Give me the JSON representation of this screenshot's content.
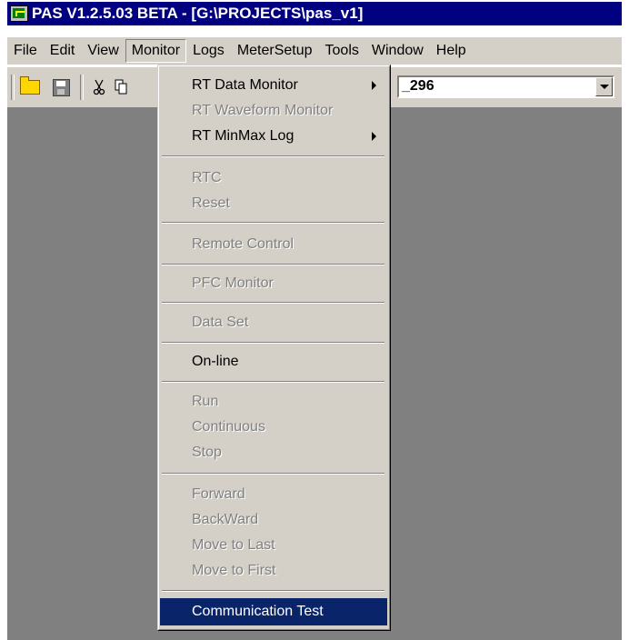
{
  "window": {
    "title": "PAS V1.2.5.03 BETA - [G:\\PROJECTS\\pas_v1]"
  },
  "menubar": {
    "items": [
      {
        "label": "File"
      },
      {
        "label": "Edit"
      },
      {
        "label": "View"
      },
      {
        "label": "Monitor"
      },
      {
        "label": "Logs"
      },
      {
        "label": "MeterSetup"
      },
      {
        "label": "Tools"
      },
      {
        "label": "Window"
      },
      {
        "label": "Help"
      }
    ]
  },
  "toolbar": {
    "combo_value": "_296",
    "icons": [
      "open-folder-icon",
      "save-icon",
      "cut-icon",
      "copy-icon"
    ]
  },
  "monitor_menu": {
    "items": [
      {
        "label": "RT Data Monitor",
        "enabled": true,
        "submenu": true
      },
      {
        "label": "RT Waveform Monitor",
        "enabled": false
      },
      {
        "label": "RT MinMax Log",
        "enabled": true,
        "submenu": true
      },
      {
        "label": "RTC",
        "enabled": false
      },
      {
        "label": "Reset",
        "enabled": false
      },
      {
        "label": "Remote Control",
        "enabled": false
      },
      {
        "label": "PFC Monitor",
        "enabled": false
      },
      {
        "label": "Data Set",
        "enabled": false
      },
      {
        "label": "On-line",
        "enabled": true
      },
      {
        "label": "Run",
        "enabled": false
      },
      {
        "label": "Continuous",
        "enabled": false
      },
      {
        "label": "Stop",
        "enabled": false
      },
      {
        "label": "Forward",
        "enabled": false
      },
      {
        "label": "BackWard",
        "enabled": false
      },
      {
        "label": "Move to Last",
        "enabled": false
      },
      {
        "label": "Move to First",
        "enabled": false
      },
      {
        "label": "Communication Test",
        "enabled": true,
        "selected": true
      }
    ]
  },
  "colors": {
    "titlebar": "#000080",
    "menu_face": "#d4d0c8",
    "workspace": "#808080",
    "selection": "#0a246a"
  }
}
